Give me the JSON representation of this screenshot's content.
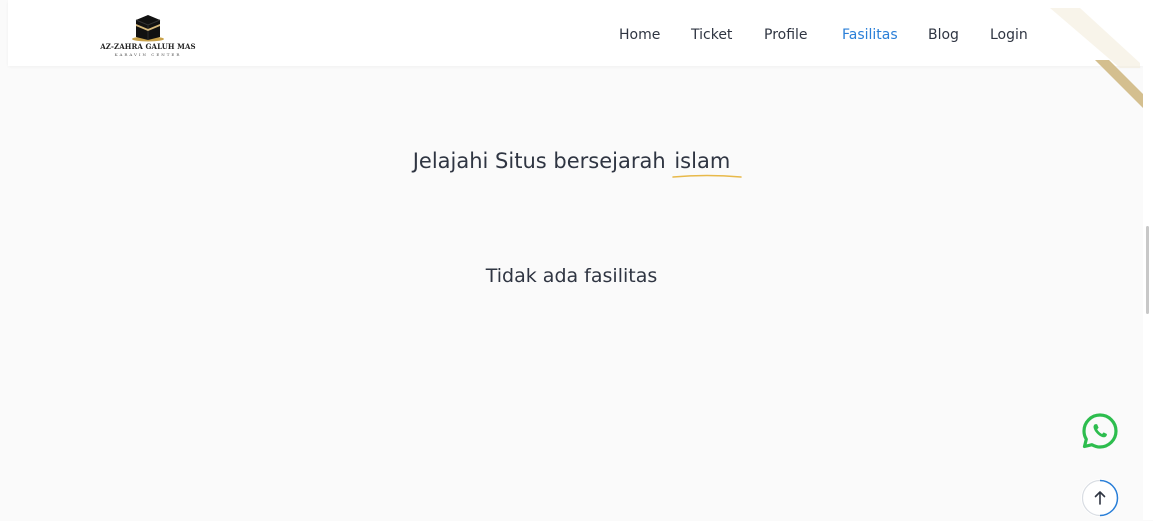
{
  "brand": {
    "name": "AZ-ZAHRA GALUH MAS",
    "tagline": "KARAVIN CENTER",
    "accent_gold": "#d4b77a",
    "link_active_color": "#2a7fd8"
  },
  "nav": {
    "items": [
      {
        "label": "Home"
      },
      {
        "label": "Ticket"
      },
      {
        "label": "Profile"
      },
      {
        "label": "Fasilitas",
        "active": true
      },
      {
        "label": "Blog"
      },
      {
        "label": "Login"
      }
    ]
  },
  "main": {
    "heading_prefix": "Jelajahi Situs bersejarah",
    "heading_accent": "islam",
    "empty_message": "Tidak ada fasilitas"
  },
  "floating": {
    "whatsapp_icon": "whatsapp-icon",
    "whatsapp_color": "#2dbd4e",
    "scroll_top_icon": "arrow-up-icon",
    "scroll_top_color": "#2a7fd8"
  }
}
